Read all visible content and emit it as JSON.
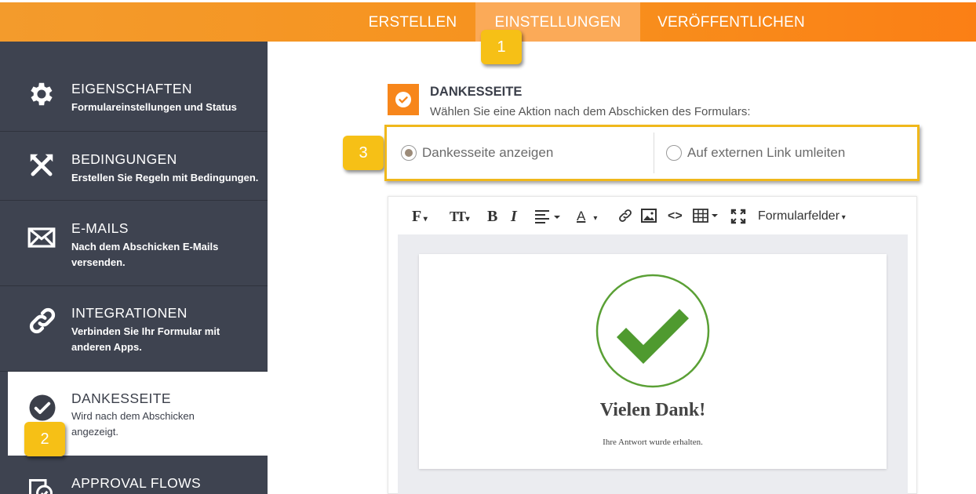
{
  "topbar": {
    "tabs": [
      {
        "label": "ERSTELLEN"
      },
      {
        "label": "EINSTELLUNGEN",
        "active": true
      },
      {
        "label": "VERÖFFENTLICHEN"
      }
    ]
  },
  "sidebar": {
    "items": [
      {
        "title": "EIGENSCHAFTEN",
        "desc": "Formulareinstellungen und Status",
        "icon": "gear-icon"
      },
      {
        "title": "BEDINGUNGEN",
        "desc": "Erstellen Sie Regeln mit Bedingungen.",
        "icon": "conditions-icon"
      },
      {
        "title": "E-MAILS",
        "desc": "Nach dem Abschicken E-Mails versenden.",
        "icon": "envelope-icon"
      },
      {
        "title": "INTEGRATIONEN",
        "desc": "Verbinden Sie Ihr Formular mit anderen Apps.",
        "icon": "link-icon"
      },
      {
        "title": "DANKESSEITE",
        "desc": "Wird nach dem Abschicken angezeigt.",
        "icon": "check-circle-icon",
        "active": true
      },
      {
        "title": "APPROVAL FLOWS",
        "desc": "",
        "icon": "approval-icon"
      }
    ]
  },
  "badges": {
    "one": "1",
    "two": "2",
    "three": "3"
  },
  "section": {
    "title": "DANKESSEITE",
    "subtitle": "Wählen Sie eine Aktion nach dem Abschicken des Formulars:"
  },
  "options": {
    "show_page": "Dankesseite anzeigen",
    "redirect": "Auf externen Link umleiten",
    "selected": "show_page"
  },
  "toolbar": {
    "font": "F",
    "size": "TT",
    "bold": "B",
    "italic": "I",
    "color": "A",
    "fields": "Formularfelder"
  },
  "thankyou": {
    "title": "Vielen Dank!",
    "subtitle": "Ihre Antwort wurde erhalten."
  },
  "colors": {
    "accent": "#f7861b",
    "sidebar": "#3e4350",
    "badge": "#f6c016",
    "check": "#4f9a2f"
  }
}
